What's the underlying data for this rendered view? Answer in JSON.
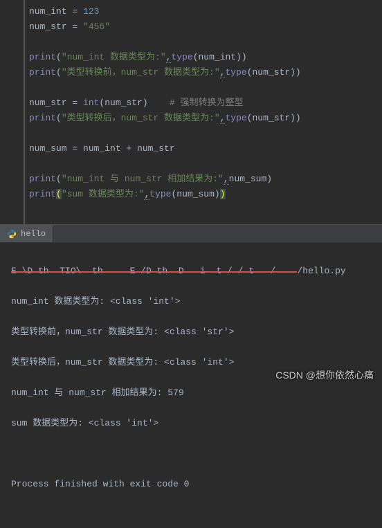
{
  "code": {
    "l1_var": "num_int",
    "l1_op": " = ",
    "l1_val": "123",
    "l2_var": "num_str",
    "l2_op": " = ",
    "l2_val": "\"456\"",
    "l4_fn": "print",
    "l4_str": "\"num_int 数据类型为:\"",
    "l4_comma": ",",
    "l4_type": "type",
    "l4_arg": "num_int",
    "l5_fn": "print",
    "l5_str": "\"类型转换前，num_str 数据类型为:\"",
    "l5_comma": ",",
    "l5_type": "type",
    "l5_arg": "num_str",
    "l7_var": "num_str",
    "l7_op": " = ",
    "l7_fn": "int",
    "l7_arg": "num_str",
    "l7_comment": "# 强制转换为整型",
    "l8_fn": "print",
    "l8_str": "\"类型转换后，num_str 数据类型为:\"",
    "l8_comma": ",",
    "l8_type": "type",
    "l8_arg": "num_str",
    "l10_var": "num_sum",
    "l10_op": " = ",
    "l10_a": "num_int",
    "l10_plus": " + ",
    "l10_b": "num_str",
    "l12_fn": "print",
    "l12_str": "\"num_int 与 num_str 相加结果为:\"",
    "l12_comma": ",",
    "l12_arg": "num_sum",
    "l13_fn": "print",
    "l13_str": "\"sum 数据类型为:\"",
    "l13_comma": ",",
    "l13_type": "type",
    "l13_arg": "num_sum"
  },
  "tab": {
    "label": "hello"
  },
  "output": {
    "path_redacted": "E \\D th  TIO\\  th     E /D th  D   i  t / / t   /    ",
    "path_tail": "/hello.py",
    "l1": "num_int 数据类型为: <class 'int'>",
    "l2": "类型转换前，num_str 数据类型为: <class 'str'>",
    "l3": "类型转换后，num_str 数据类型为: <class 'int'>",
    "l4": "num_int 与 num_str 相加结果为: 579",
    "l5": "sum 数据类型为: <class 'int'>",
    "exit": "Process finished with exit code 0"
  },
  "watermark": "CSDN @想你依然心痛"
}
